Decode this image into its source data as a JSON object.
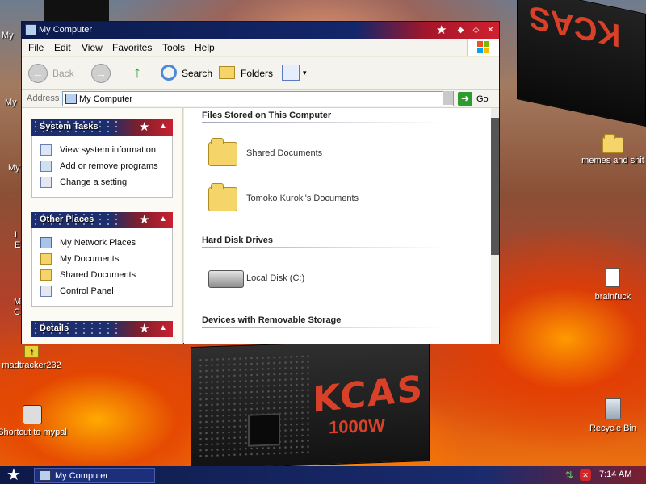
{
  "window": {
    "title": "My Computer",
    "menu": [
      "File",
      "Edit",
      "View",
      "Favorites",
      "Tools",
      "Help"
    ],
    "toolbar": {
      "back_label": "Back",
      "search_label": "Search",
      "folders_label": "Folders"
    },
    "address": {
      "label": "Address",
      "value": "My Computer",
      "go_label": "Go"
    }
  },
  "left_pane": {
    "system_tasks": {
      "title": "System Tasks",
      "items": [
        "View system information",
        "Add or remove programs",
        "Change a setting"
      ]
    },
    "other_places": {
      "title": "Other Places",
      "items": [
        "My Network Places",
        "My Documents",
        "Shared Documents",
        "Control Panel"
      ]
    },
    "details": {
      "title": "Details"
    }
  },
  "right_pane": {
    "sections": [
      {
        "title": "Files Stored on This Computer",
        "items": [
          "Shared Documents",
          "Tomoko Kuroki's Documents"
        ]
      },
      {
        "title": "Hard Disk Drives",
        "items": [
          "Local Disk (C:)"
        ]
      },
      {
        "title": "Devices with Removable Storage",
        "items": []
      }
    ]
  },
  "desktop": {
    "icons_left_partial": [
      "My",
      "My",
      "My",
      "I",
      "E",
      "M",
      "C"
    ],
    "icons": {
      "madtracker": "madtracker232",
      "shortcut": "Shortcut to mypal",
      "memes": "memes and shit",
      "brainfuck": "brainfuck",
      "recycle": "Recycle Bin"
    },
    "wallpaper_text": {
      "brand": "KCAS",
      "wattage": "1000W"
    }
  },
  "taskbar": {
    "task_label": "My Computer",
    "clock": "7:14 AM"
  },
  "colors": {
    "title_navy": "#13266a",
    "title_red": "#d0202f",
    "taskbar_navy": "#1a2b6e"
  }
}
